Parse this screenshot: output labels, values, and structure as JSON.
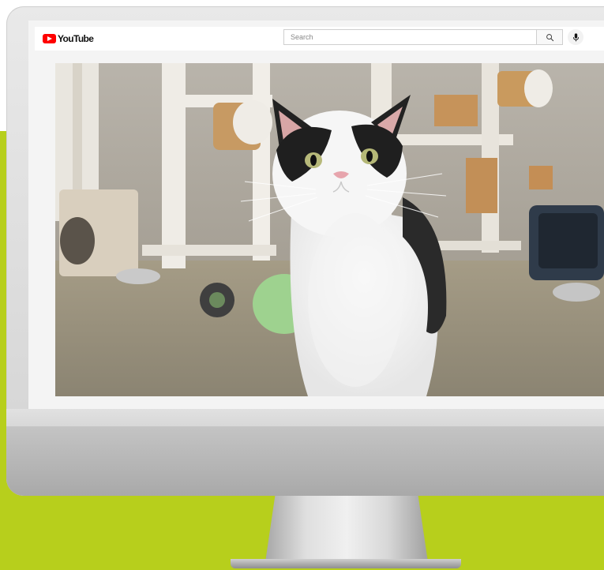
{
  "header": {
    "logo_text": "YouTube",
    "search_placeholder": "Search"
  },
  "icons": {
    "logo": "youtube-play-icon",
    "search": "search-icon",
    "mic": "microphone-icon"
  },
  "colors": {
    "brand_red": "#ff0000",
    "background_band": "#b7cf1c",
    "monitor_frame": "#e5e5e5"
  },
  "video": {
    "content": "cat-video-frame"
  }
}
